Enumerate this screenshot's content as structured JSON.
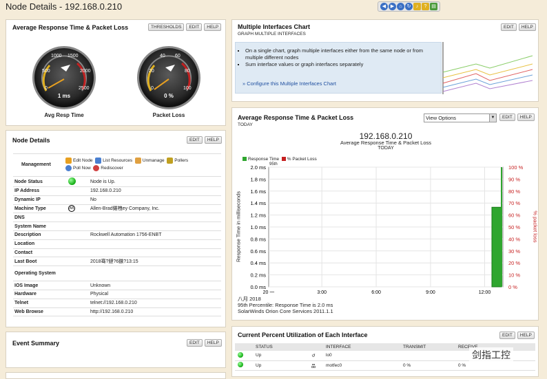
{
  "page": {
    "title": "Node Details - 192.168.0.210"
  },
  "top_icons": [
    "back-icon",
    "forward-icon",
    "home-icon",
    "sound-icon",
    "help-icon",
    "print-icon"
  ],
  "resp_panel": {
    "title": "Average Response Time & Packet Loss",
    "buttons": [
      "THRESHOLDS",
      "EDIT",
      "HELP"
    ],
    "gauge1": {
      "ticks": [
        "500",
        "1000",
        "1500",
        "2000",
        "2500",
        "0"
      ],
      "value": "1 ms",
      "label": "Avg Resp Time"
    },
    "gauge2": {
      "ticks": [
        "20",
        "40",
        "60",
        "80",
        "100",
        "0"
      ],
      "value": "0 %",
      "label": "Packet Loss"
    }
  },
  "node_panel": {
    "title": "Node Details",
    "buttons": [
      "EDIT",
      "HELP"
    ],
    "management_label": "Management",
    "management_links": [
      "Edit Node",
      "List Resources",
      "Unmanage",
      "Pollers",
      "Poll Now",
      "Rediscover"
    ],
    "rows": [
      {
        "k": "Node Status",
        "v": "Node is Up."
      },
      {
        "k": "IP Address",
        "v": "192.168.0.210"
      },
      {
        "k": "Dynamic IP",
        "v": "No"
      },
      {
        "k": "Machine Type",
        "v": "Allen-Brad鍖栧ey Company, Inc."
      },
      {
        "k": "DNS",
        "v": ""
      },
      {
        "k": "System Name",
        "v": ""
      },
      {
        "k": "Description",
        "v": "Rockwell Automation 1756-ENBT"
      },
      {
        "k": "Location",
        "v": ""
      },
      {
        "k": "Contact",
        "v": ""
      },
      {
        "k": "Last Boot",
        "v": "2018骞?鏈?6鏃?13:15"
      },
      {
        "k": "Operating System",
        "v": ""
      },
      {
        "k": "IOS Image",
        "v": "Unknown"
      },
      {
        "k": "Hardware",
        "v": "Physical"
      },
      {
        "k": "Telnet",
        "v": "telnet://192.168.0.210"
      },
      {
        "k": "Web Browse",
        "v": "http://192.168.0.210"
      }
    ]
  },
  "event_panel": {
    "title": "Event Summary",
    "buttons": [
      "EDIT",
      "HELP"
    ]
  },
  "multi_panel": {
    "title": "Multiple Interfaces Chart",
    "subtitle": "GRAPH MULTIPLE INTERFACES",
    "buttons": [
      "EDIT",
      "HELP"
    ],
    "bullets": [
      "On a single chart, graph multiple interfaces either from the same node or from multiple different nodes",
      "Sum interface values or graph interfaces separately"
    ],
    "link": "» Configure this Multiple Interfaces Chart"
  },
  "chart_panel": {
    "title": "Average Response Time & Packet Loss",
    "subtitle": "TODAY",
    "view_options": "View Options",
    "buttons": [
      "EDIT",
      "HELP"
    ],
    "chart_title": "192.168.0.210",
    "chart_subtitle": "Average Response Time & Packet Loss",
    "chart_subtitle2": "TODAY",
    "legend": [
      "Response Time",
      "% Packet Loss"
    ],
    "legend_note": "95th",
    "ylabel": "Response Time in milliseconds",
    "y2label": "% packet loss",
    "date_label": "八月 2018",
    "percentile": "95th Percentile: Response Time is 2.0  ms",
    "footer": "SolarWinds Orion Core Services 2011.1.1"
  },
  "chart_data": {
    "type": "bar",
    "title": "192.168.0.210",
    "xlabel": "",
    "ylabel": "Response Time in milliseconds",
    "x_ticks": [
      "20 一",
      "3:00",
      "6:00",
      "9:00",
      "12:00"
    ],
    "y_ticks": [
      "0.0 ms",
      "0.2 ms",
      "0.4 ms",
      "0.6 ms",
      "0.8 ms",
      "1.0 ms",
      "1.2 ms",
      "1.4 ms",
      "1.6 ms",
      "1.8 ms",
      "2.0 ms"
    ],
    "y2_ticks": [
      "0 %",
      "10 %",
      "20 %",
      "30 %",
      "40 %",
      "50 %",
      "60 %",
      "70 %",
      "80 %",
      "90 %",
      "100 %"
    ],
    "ylim": [
      0,
      2.0
    ],
    "y2lim": [
      0,
      100
    ],
    "series": [
      {
        "name": "Response Time",
        "values": [
          1.33
        ]
      },
      {
        "name": "% Packet Loss",
        "values": [
          0
        ]
      }
    ],
    "colors": {
      "response": "#2fa62f",
      "loss": "#c62020"
    }
  },
  "util_panel": {
    "title": "Current Percent Utilization of Each Interface",
    "buttons": [
      "EDIT",
      "HELP"
    ],
    "headers": [
      "STATUS",
      "INTERFACE",
      "TRANSMIT",
      "RECEIVE"
    ],
    "rows": [
      {
        "status": "Up",
        "interface": "lo0",
        "transmit": "",
        "receive": ""
      },
      {
        "status": "Up",
        "interface": "motfec0",
        "transmit": "0 %",
        "receive": "0 %"
      }
    ]
  },
  "watermark": "剑指工控"
}
